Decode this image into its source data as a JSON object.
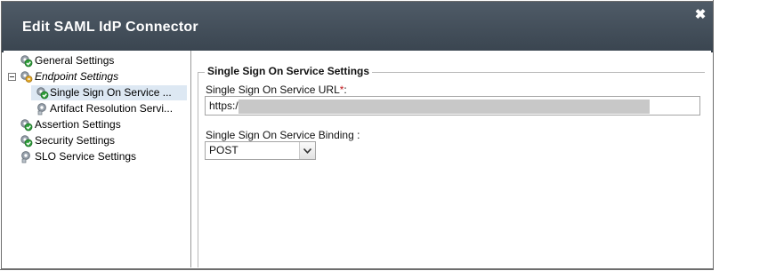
{
  "dialog": {
    "title": "Edit SAML IdP Connector",
    "close_glyph": "✖"
  },
  "tree": {
    "items": [
      {
        "label": "General Settings",
        "icon": "check-gear-icon",
        "italic": false,
        "selected": false
      },
      {
        "label": "Endpoint Settings",
        "icon": "gear-folder-icon",
        "italic": true,
        "selected": false,
        "expanded": true
      },
      {
        "label": "Single Sign On Service ...",
        "icon": "check-gear-icon",
        "italic": false,
        "selected": true
      },
      {
        "label": "Artifact Resolution Servi...",
        "icon": "gear-icon",
        "italic": false,
        "selected": false
      },
      {
        "label": "Assertion Settings",
        "icon": "check-gear-icon",
        "italic": false,
        "selected": false
      },
      {
        "label": "Security Settings",
        "icon": "check-gear-icon",
        "italic": false,
        "selected": false
      },
      {
        "label": "SLO Service Settings",
        "icon": "gear-icon",
        "italic": false,
        "selected": false
      }
    ]
  },
  "form": {
    "section_title": "Single Sign On Service Settings",
    "url_label": "Single Sign On Service URL",
    "url_required_mark": "*",
    "url_label_suffix": ":",
    "url_value": "https:/",
    "binding_label": "Single Sign On Service Binding",
    "binding_label_suffix": ":",
    "binding_value": "POST"
  }
}
